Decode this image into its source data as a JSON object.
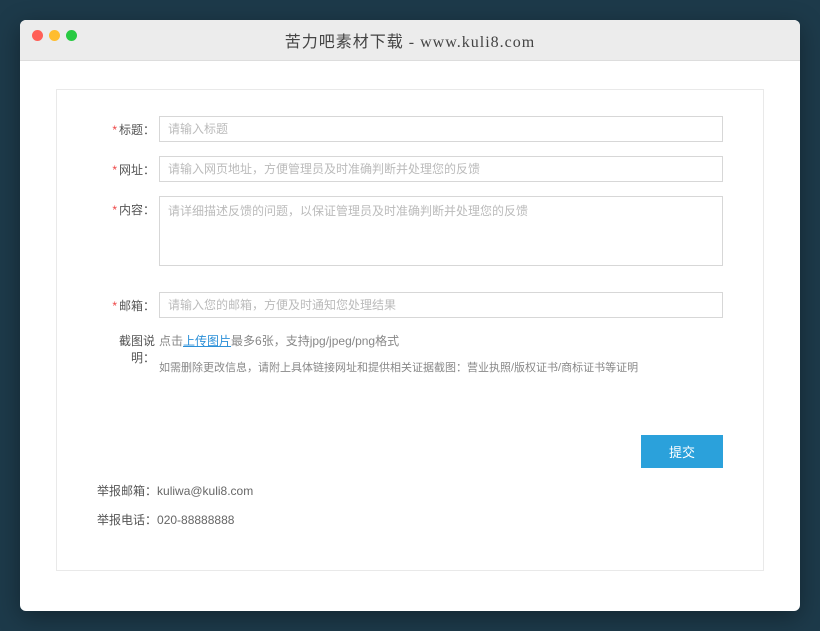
{
  "titlebar": {
    "title": "苦力吧素材下载 - www.kuli8.com"
  },
  "form": {
    "title_label": "标题：",
    "title_placeholder": "请输入标题",
    "url_label": "网址：",
    "url_placeholder": "请输入网页地址，方便管理员及时准确判断并处理您的反馈",
    "content_label": "内容：",
    "content_placeholder": "请详细描述反馈的问题，以保证管理员及时准确判断并处理您的反馈",
    "email_label": "邮箱：",
    "email_placeholder": "请输入您的邮箱，方便及时通知您处理结果",
    "screenshot_label": "截图说明：",
    "upload_prefix": "点击",
    "upload_link": "上传图片",
    "upload_suffix": "最多6张，支持jpg/jpeg/png格式",
    "delete_notice": "如需删除更改信息，请附上具体链接网址和提供相关证据截图：营业执照/版权证书/商标证书等证明",
    "submit_label": "提交"
  },
  "footer": {
    "report_email_label": "举报邮箱：",
    "report_email_value": "kuliwa@kuli8.com",
    "report_phone_label": "举报电话：",
    "report_phone_value": "020-88888888"
  }
}
